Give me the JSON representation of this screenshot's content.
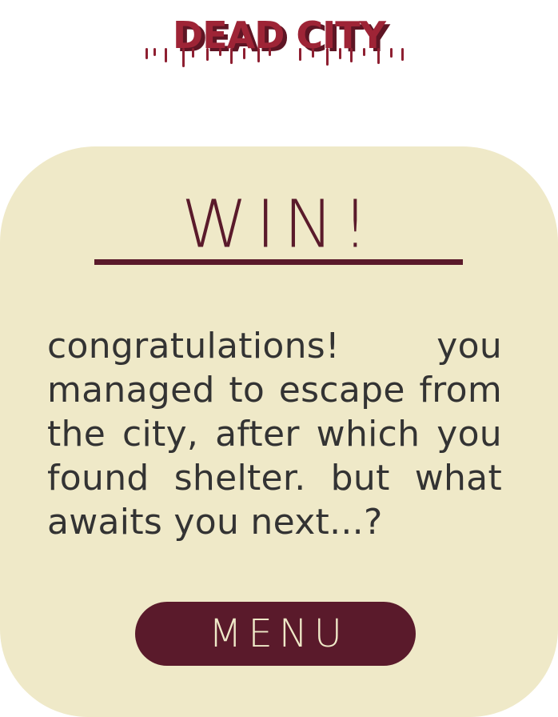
{
  "app": {
    "logo_text": "DEAD CITY"
  },
  "result": {
    "title": "WIN!",
    "message": "congratulations! you managed to escape from the city, after which you found shelter. but what awaits you next...?"
  },
  "actions": {
    "menu_label": "MENU"
  },
  "colors": {
    "accent": "#5a1a2b",
    "logo": "#9e2436",
    "card_background": "#efe9c8",
    "text": "#333333"
  }
}
